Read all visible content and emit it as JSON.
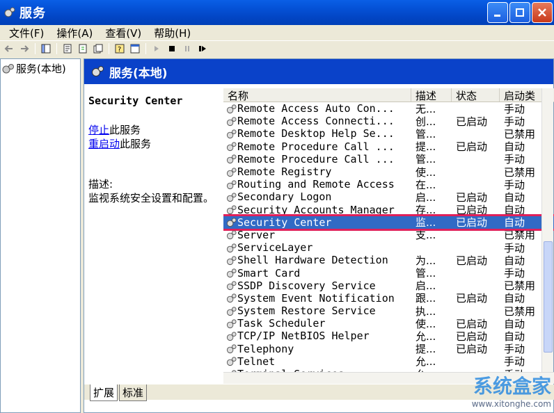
{
  "window": {
    "title": "服务"
  },
  "menu": [
    "文件(F)",
    "操作(A)",
    "查看(V)",
    "帮助(H)"
  ],
  "tree": {
    "root_label": "服务(本地)"
  },
  "pane": {
    "header": "服务(本地)"
  },
  "detail": {
    "service_name": "Security Center",
    "stop_link": "停止",
    "stop_suffix": "此服务",
    "restart_link": "重启动",
    "restart_suffix": "此服务",
    "desc_label": "描述:",
    "desc_text": "监视系统安全设置和配置。"
  },
  "columns": {
    "name": "名称",
    "desc": "描述",
    "status": "状态",
    "startup": "启动类"
  },
  "rows": [
    {
      "name": "Remote Access Auto Con...",
      "desc": "无...",
      "status": "",
      "startup": "手动"
    },
    {
      "name": "Remote Access Connecti...",
      "desc": "创...",
      "status": "已启动",
      "startup": "手动"
    },
    {
      "name": "Remote Desktop Help Se...",
      "desc": "管...",
      "status": "",
      "startup": "已禁用"
    },
    {
      "name": "Remote Procedure Call ...",
      "desc": "提...",
      "status": "已启动",
      "startup": "自动"
    },
    {
      "name": "Remote Procedure Call ...",
      "desc": "管...",
      "status": "",
      "startup": "手动"
    },
    {
      "name": "Remote Registry",
      "desc": "使...",
      "status": "",
      "startup": "已禁用"
    },
    {
      "name": "Routing and Remote Access",
      "desc": "在...",
      "status": "",
      "startup": "手动"
    },
    {
      "name": "Secondary Logon",
      "desc": "启...",
      "status": "已启动",
      "startup": "自动"
    },
    {
      "name": "Security Accounts Manager",
      "desc": "存...",
      "status": "已启动",
      "startup": "自动"
    },
    {
      "name": "Security Center",
      "desc": "监...",
      "status": "已启动",
      "startup": "自动"
    },
    {
      "name": "Server",
      "desc": "支...",
      "status": "",
      "startup": "已禁用"
    },
    {
      "name": "ServiceLayer",
      "desc": "",
      "status": "",
      "startup": "手动"
    },
    {
      "name": "Shell Hardware Detection",
      "desc": "为...",
      "status": "已启动",
      "startup": "自动"
    },
    {
      "name": "Smart Card",
      "desc": "管...",
      "status": "",
      "startup": "手动"
    },
    {
      "name": "SSDP Discovery Service",
      "desc": "启...",
      "status": "",
      "startup": "已禁用"
    },
    {
      "name": "System Event Notification",
      "desc": "跟...",
      "status": "已启动",
      "startup": "自动"
    },
    {
      "name": "System Restore Service",
      "desc": "执...",
      "status": "",
      "startup": "已禁用"
    },
    {
      "name": "Task Scheduler",
      "desc": "使...",
      "status": "已启动",
      "startup": "自动"
    },
    {
      "name": "TCP/IP NetBIOS Helper",
      "desc": "允...",
      "status": "已启动",
      "startup": "自动"
    },
    {
      "name": "Telephony",
      "desc": "提...",
      "status": "已启动",
      "startup": "手动"
    },
    {
      "name": "Telnet",
      "desc": "允...",
      "status": "",
      "startup": "手动"
    },
    {
      "name": "Terminal Services",
      "desc": "允...",
      "status": "",
      "startup": "手动"
    }
  ],
  "selected_row": 9,
  "tabs": [
    "扩展",
    "标准"
  ],
  "watermark": {
    "title": "系统盒家",
    "url": "www.xitonghe.com"
  }
}
